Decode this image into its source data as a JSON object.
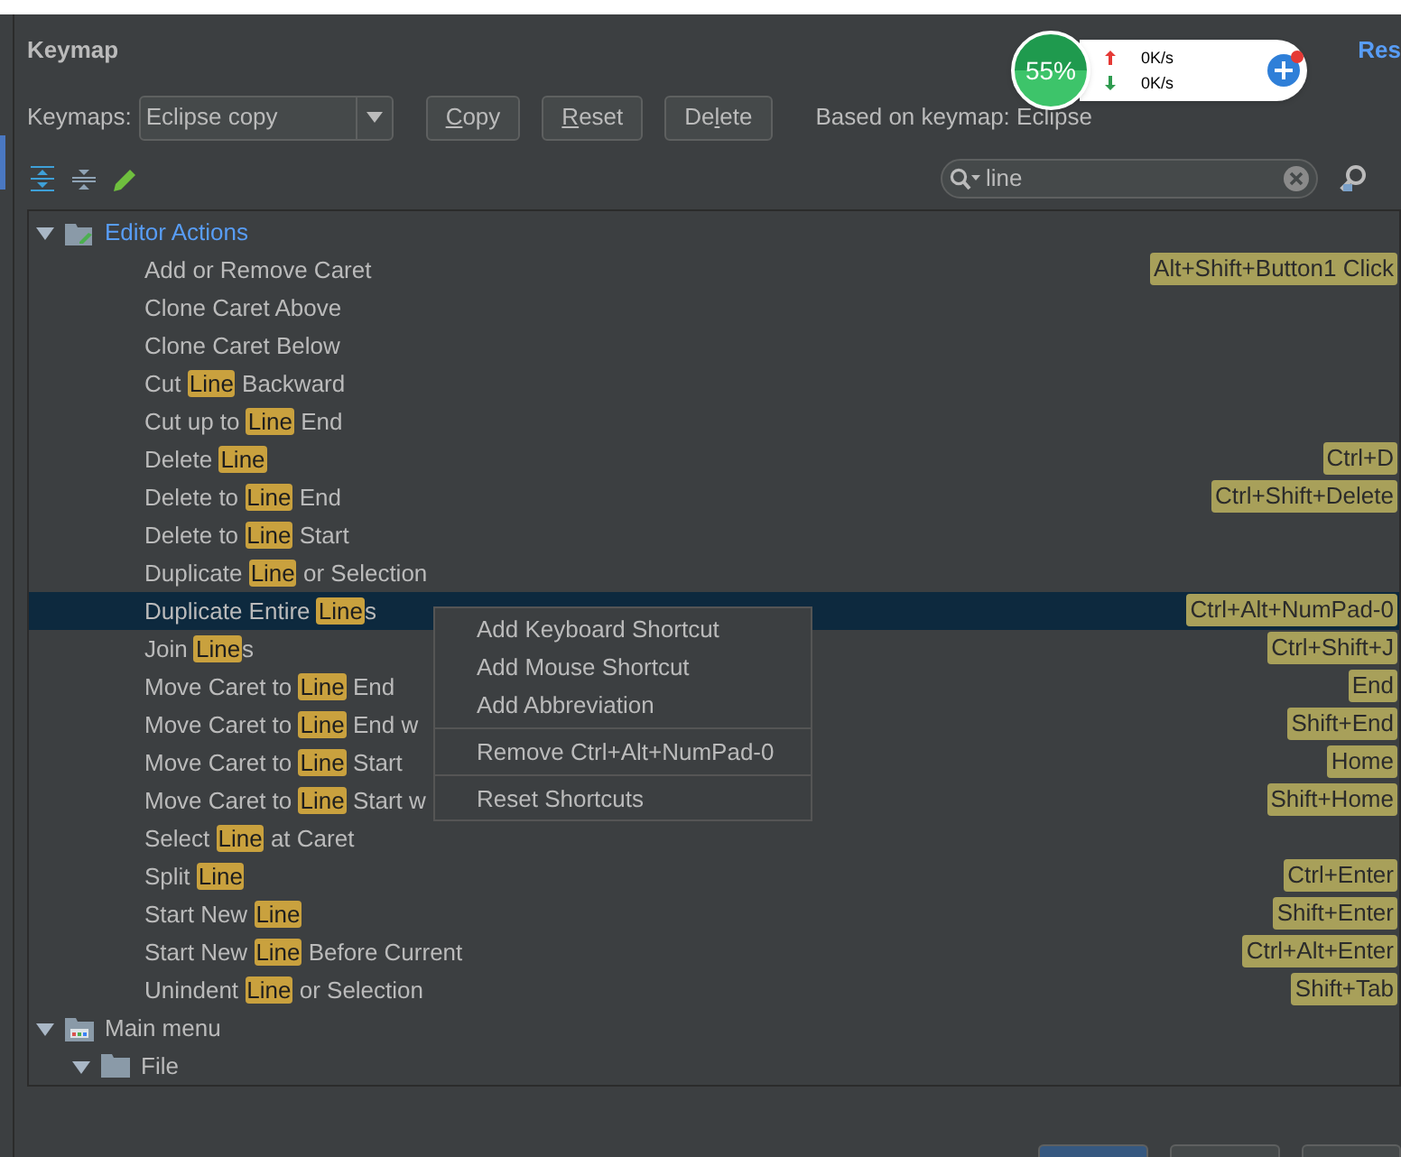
{
  "top_link": "Res",
  "title": "Keymap",
  "keymap_label": "Keymaps:",
  "keymap_select": {
    "value": "Eclipse copy"
  },
  "buttons": [
    {
      "parts": [
        {
          "text": "C",
          "underline": true
        },
        {
          "text": "opy",
          "underline": false
        }
      ]
    },
    {
      "parts": [
        {
          "text": "R",
          "underline": true
        },
        {
          "text": "eset",
          "underline": false
        }
      ]
    },
    {
      "parts": [
        {
          "text": "De",
          "underline": false
        },
        {
          "text": "l",
          "underline": true
        },
        {
          "text": "ete",
          "underline": false
        }
      ]
    }
  ],
  "based_on": "Based on keymap: Eclipse",
  "monitor": {
    "percent": "55%",
    "upload": "0K/s",
    "download": "0K/s"
  },
  "search": {
    "value": "line"
  },
  "tree": [
    {
      "kind": "group",
      "parts": [
        {
          "text": "Editor Actions",
          "match": false
        }
      ],
      "expanded": true,
      "selected": false,
      "link": true,
      "children": [
        {
          "kind": "action",
          "parts": [
            {
              "text": "Add or Remove Caret",
              "match": false
            }
          ],
          "shortcut": "Alt+Shift+Button1 Click",
          "selected": false
        },
        {
          "kind": "action",
          "parts": [
            {
              "text": "Clone Caret Above",
              "match": false
            }
          ],
          "selected": false
        },
        {
          "kind": "action",
          "parts": [
            {
              "text": "Clone Caret Below",
              "match": false
            }
          ],
          "selected": false
        },
        {
          "kind": "action",
          "parts": [
            {
              "text": "Cut ",
              "match": false
            },
            {
              "text": "Line",
              "match": true
            },
            {
              "text": " Backward",
              "match": false
            }
          ],
          "selected": false
        },
        {
          "kind": "action",
          "parts": [
            {
              "text": "Cut up to ",
              "match": false
            },
            {
              "text": "Line",
              "match": true
            },
            {
              "text": " End",
              "match": false
            }
          ],
          "selected": false
        },
        {
          "kind": "action",
          "parts": [
            {
              "text": "Delete ",
              "match": false
            },
            {
              "text": "Line",
              "match": true
            }
          ],
          "shortcut": "Ctrl+D",
          "selected": false
        },
        {
          "kind": "action",
          "parts": [
            {
              "text": "Delete to ",
              "match": false
            },
            {
              "text": "Line",
              "match": true
            },
            {
              "text": " End",
              "match": false
            }
          ],
          "shortcut": "Ctrl+Shift+Delete",
          "selected": false
        },
        {
          "kind": "action",
          "parts": [
            {
              "text": "Delete to ",
              "match": false
            },
            {
              "text": "Line",
              "match": true
            },
            {
              "text": " Start",
              "match": false
            }
          ],
          "selected": false
        },
        {
          "kind": "action",
          "parts": [
            {
              "text": "Duplicate ",
              "match": false
            },
            {
              "text": "Line",
              "match": true
            },
            {
              "text": " or Selection",
              "match": false
            }
          ],
          "selected": false
        },
        {
          "kind": "action",
          "parts": [
            {
              "text": "Duplicate Entire ",
              "match": false
            },
            {
              "text": "Line",
              "match": true
            },
            {
              "text": "s",
              "match": false
            }
          ],
          "shortcut": "Ctrl+Alt+NumPad-0",
          "selected": true
        },
        {
          "kind": "action",
          "parts": [
            {
              "text": "Join ",
              "match": false
            },
            {
              "text": "Line",
              "match": true
            },
            {
              "text": "s",
              "match": false
            }
          ],
          "shortcut": "Ctrl+Shift+J",
          "selected": false
        },
        {
          "kind": "action",
          "parts": [
            {
              "text": "Move Caret to ",
              "match": false
            },
            {
              "text": "Line",
              "match": true
            },
            {
              "text": " End",
              "match": false
            }
          ],
          "shortcut": "End",
          "selected": false
        },
        {
          "kind": "action",
          "parts": [
            {
              "text": "Move Caret to ",
              "match": false
            },
            {
              "text": "Line",
              "match": true
            },
            {
              "text": " End w",
              "match": false
            }
          ],
          "shortcut": "Shift+End",
          "selected": false
        },
        {
          "kind": "action",
          "parts": [
            {
              "text": "Move Caret to ",
              "match": false
            },
            {
              "text": "Line",
              "match": true
            },
            {
              "text": " Start",
              "match": false
            }
          ],
          "shortcut": "Home",
          "selected": false
        },
        {
          "kind": "action",
          "parts": [
            {
              "text": "Move Caret to ",
              "match": false
            },
            {
              "text": "Line",
              "match": true
            },
            {
              "text": " Start w",
              "match": false
            }
          ],
          "shortcut": "Shift+Home",
          "selected": false
        },
        {
          "kind": "action",
          "parts": [
            {
              "text": "Select ",
              "match": false
            },
            {
              "text": "Line",
              "match": true
            },
            {
              "text": " at Caret",
              "match": false
            }
          ],
          "selected": false
        },
        {
          "kind": "action",
          "parts": [
            {
              "text": "Split ",
              "match": false
            },
            {
              "text": "Line",
              "match": true
            }
          ],
          "shortcut": "Ctrl+Enter",
          "selected": false
        },
        {
          "kind": "action",
          "parts": [
            {
              "text": "Start New ",
              "match": false
            },
            {
              "text": "Line",
              "match": true
            }
          ],
          "shortcut": "Shift+Enter",
          "selected": false
        },
        {
          "kind": "action",
          "parts": [
            {
              "text": "Start New ",
              "match": false
            },
            {
              "text": "Line",
              "match": true
            },
            {
              "text": " Before Current",
              "match": false
            }
          ],
          "shortcut": "Ctrl+Alt+Enter",
          "selected": false
        },
        {
          "kind": "action",
          "parts": [
            {
              "text": "Unindent ",
              "match": false
            },
            {
              "text": "Line",
              "match": true
            },
            {
              "text": " or Selection",
              "match": false
            }
          ],
          "shortcut": "Shift+Tab",
          "selected": false
        }
      ]
    },
    {
      "kind": "menu",
      "parts": [
        {
          "text": "Main menu",
          "match": false
        }
      ],
      "expanded": true,
      "selected": false,
      "link": false,
      "children": [
        {
          "kind": "folder",
          "parts": [
            {
              "text": "File",
              "match": false
            }
          ],
          "expanded": true,
          "selected": false,
          "link": false
        }
      ]
    }
  ],
  "context_menu": [
    {
      "kind": "item",
      "label": "Add Keyboard Shortcut"
    },
    {
      "kind": "item",
      "label": "Add Mouse Shortcut"
    },
    {
      "kind": "item",
      "label": "Add Abbreviation"
    },
    {
      "kind": "separator"
    },
    {
      "kind": "item",
      "label": "Remove Ctrl+Alt+NumPad-0"
    },
    {
      "kind": "separator"
    },
    {
      "kind": "item",
      "label": "Reset Shortcuts"
    }
  ]
}
